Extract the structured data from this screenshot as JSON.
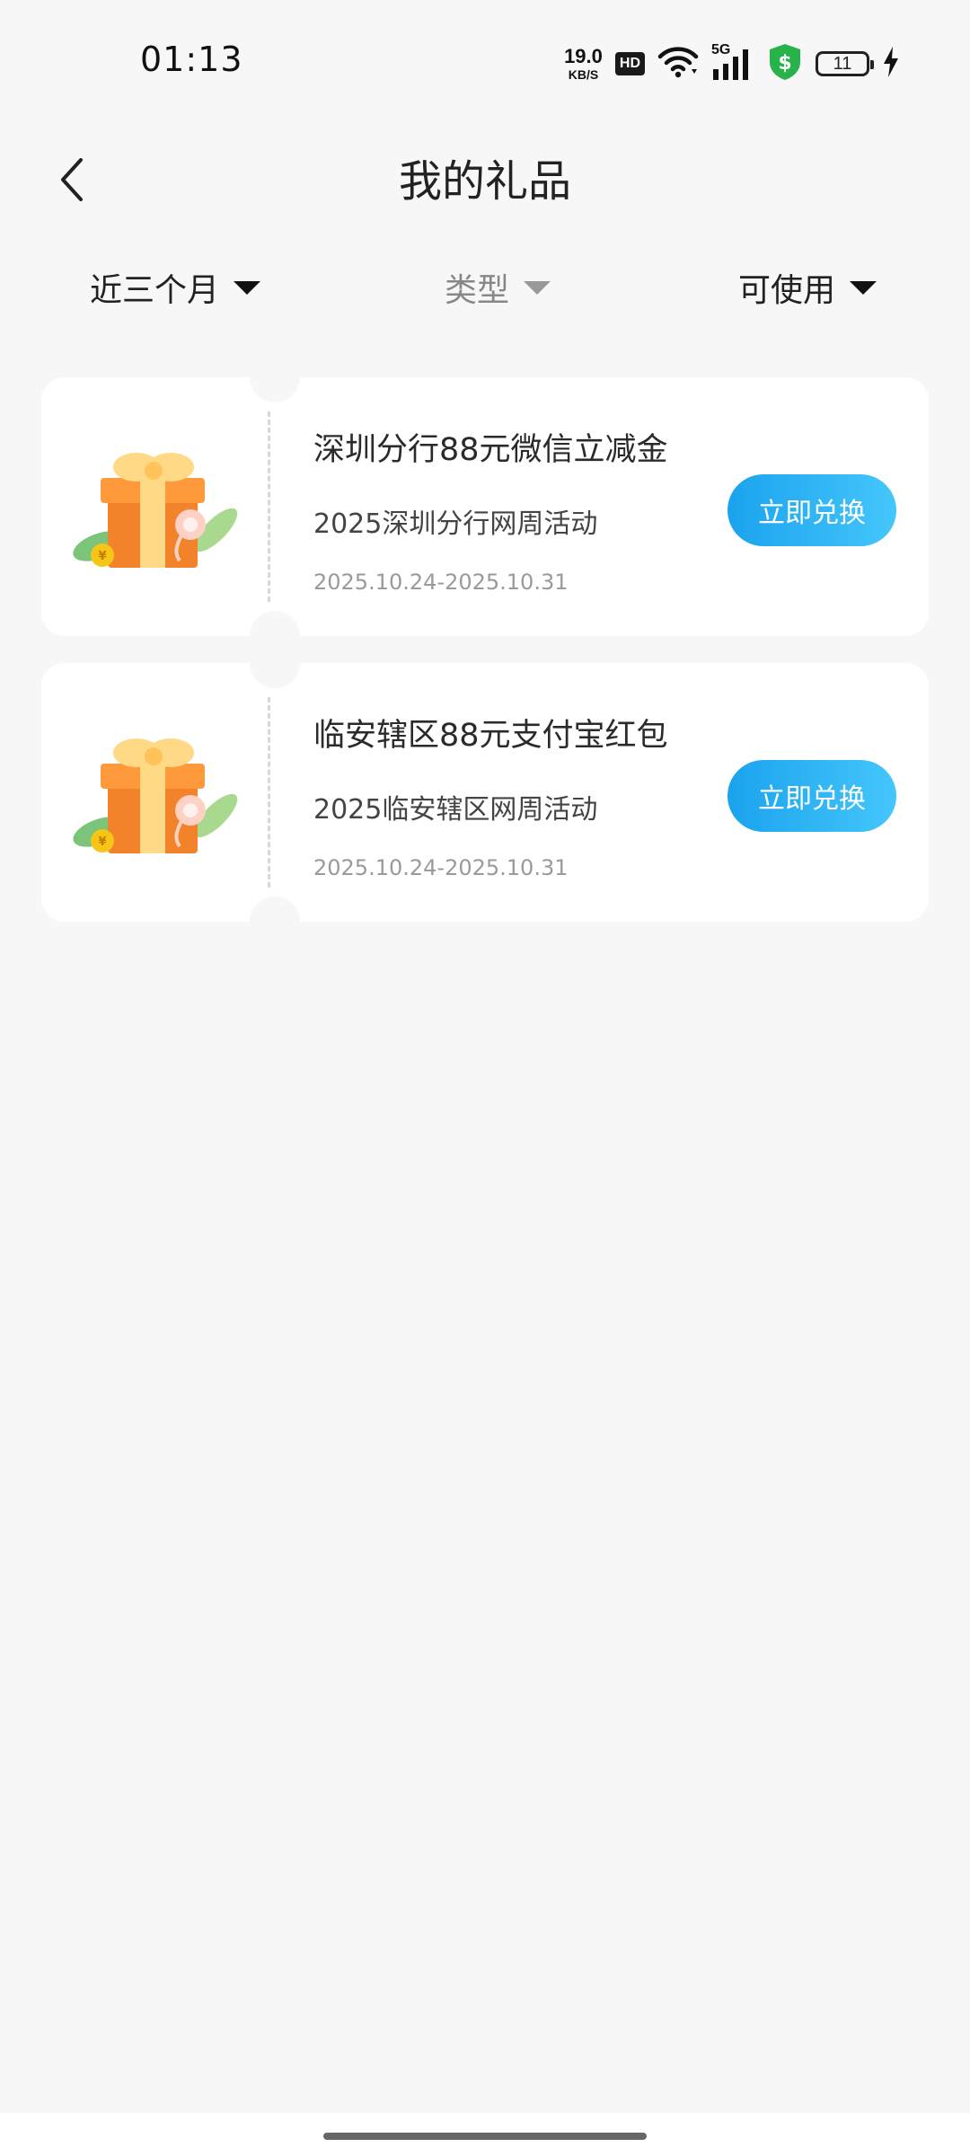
{
  "status_bar": {
    "time": "01:13",
    "net_speed_value": "19.0",
    "net_speed_unit": "KB/S",
    "hd_label": "HD",
    "network_label": "5G",
    "battery_level": "11",
    "icons": [
      "wifi-icon",
      "cellular-signal-icon",
      "payment-shield-icon",
      "battery-icon",
      "charging-icon"
    ]
  },
  "header": {
    "title": "我的礼品"
  },
  "filters": {
    "period": "近三个月",
    "type": "类型",
    "status": "可使用"
  },
  "gifts": [
    {
      "title": "深圳分行88元微信立减金",
      "subtitle": "2025深圳分行网周活动",
      "date_range": "2025.10.24-2025.10.31",
      "button_label": "立即兑换"
    },
    {
      "title": "临安辖区88元支付宝红包",
      "subtitle": "2025临安辖区网周活动",
      "date_range": "2025.10.24-2025.10.31",
      "button_label": "立即兑换"
    }
  ],
  "colors": {
    "background": "#f7f7f7",
    "card": "#ffffff",
    "button_gradient_start": "#1aa3ee",
    "button_gradient_end": "#45c6fb",
    "shield_green": "#27b24a"
  }
}
